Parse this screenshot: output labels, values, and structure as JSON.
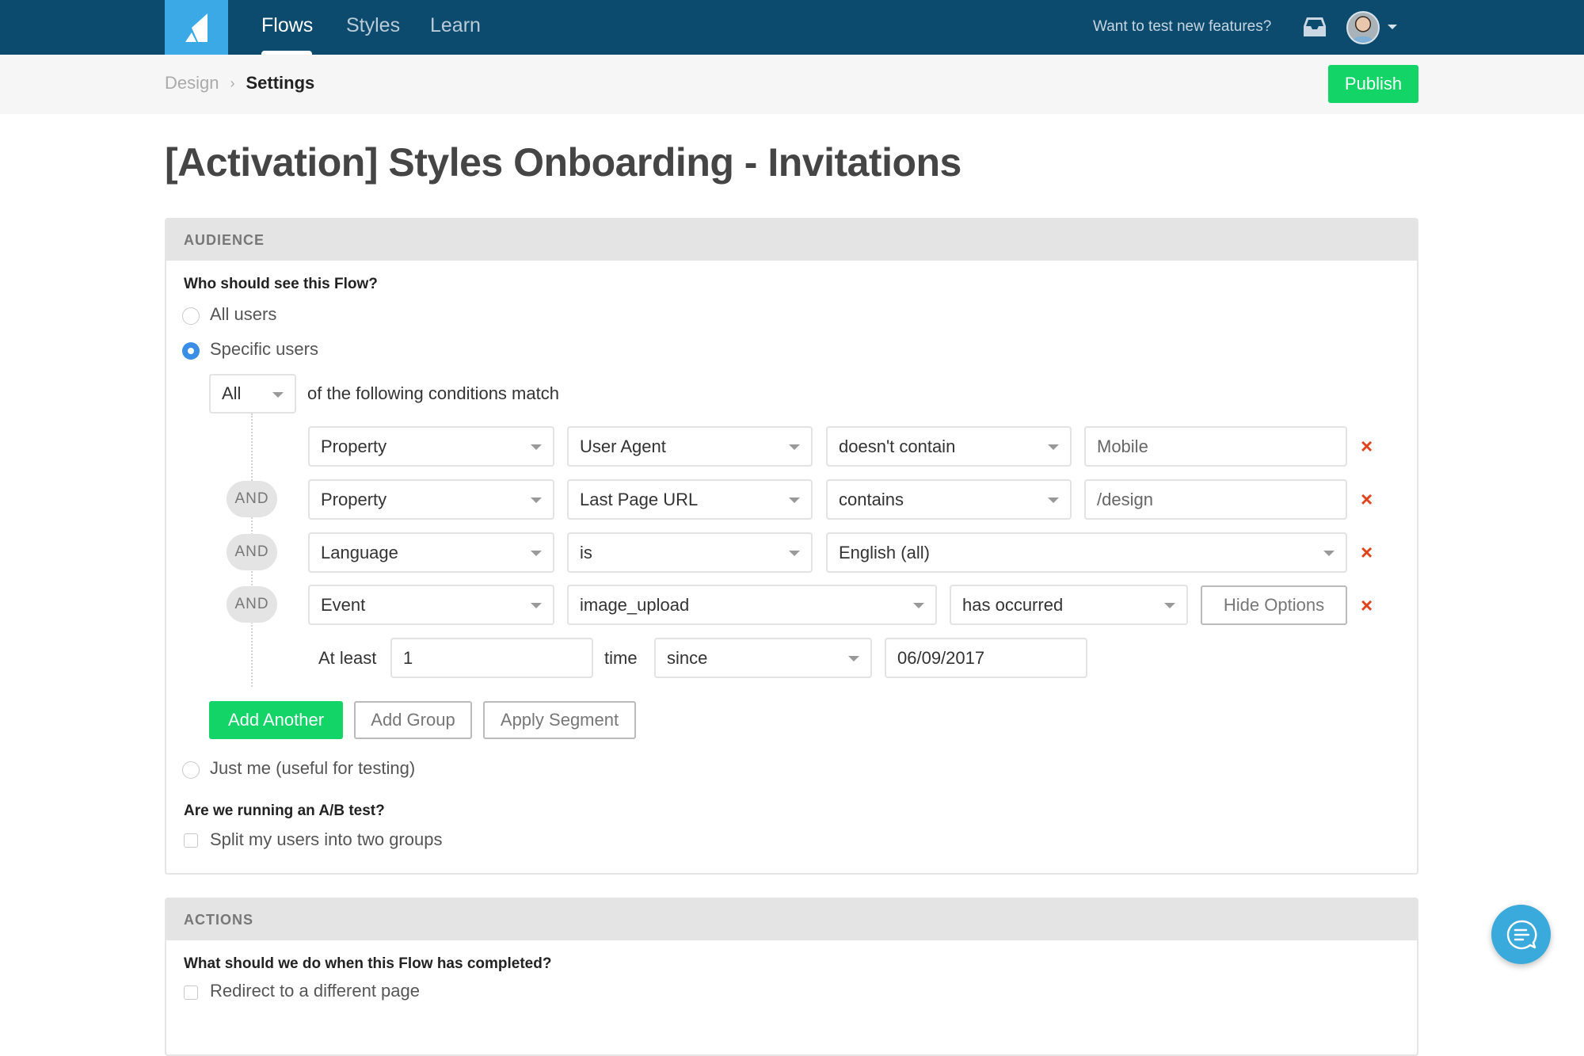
{
  "navbar": {
    "logo": "appcues-logo-icon",
    "tabs": [
      {
        "label": "Flows",
        "active": true
      },
      {
        "label": "Styles",
        "active": false
      },
      {
        "label": "Learn",
        "active": false
      }
    ],
    "feature_link": "Want to test new features?",
    "inbox_icon": "inbox-icon",
    "avatar": "user-avatar",
    "caret_icon": "caret-down-icon"
  },
  "breadcrumb": {
    "parent": "Design",
    "separator": "›",
    "current": "Settings"
  },
  "toolbar": {
    "publish_label": "Publish"
  },
  "page_title": "[Activation] Styles Onboarding - Invitations",
  "audience": {
    "header": "AUDIENCE",
    "question": "Who should see this Flow?",
    "options": [
      {
        "label": "All users",
        "checked": false
      },
      {
        "label": "Specific users",
        "checked": true
      },
      {
        "label": "Just me (useful for testing)",
        "checked": false
      }
    ],
    "match_select": "All",
    "match_text": "of the following conditions match",
    "connector": "AND",
    "conditions": [
      {
        "type": "Property",
        "field": "User Agent",
        "operator": "doesn't contain",
        "value": "Mobile"
      },
      {
        "type": "Property",
        "field": "Last Page URL",
        "operator": "contains",
        "value": "/design"
      },
      {
        "type": "Language",
        "operator": "is",
        "value": "English (all)"
      },
      {
        "type": "Event",
        "field": "image_upload",
        "operator": "has occurred",
        "options_button": "Hide Options"
      }
    ],
    "event_options": {
      "at_least_label": "At least",
      "count": "1",
      "time_label": "time",
      "since_select": "since",
      "date": "06/09/2017"
    },
    "remove_icon": "×",
    "buttons": {
      "add_another": "Add Another",
      "add_group": "Add Group",
      "apply_segment": "Apply Segment"
    },
    "ab_question": "Are we running an A/B test?",
    "ab_option": {
      "label": "Split my users into two groups",
      "checked": false
    }
  },
  "actions": {
    "header": "ACTIONS",
    "question": "What should we do when this Flow has completed?",
    "option": {
      "label": "Redirect to a different page",
      "checked": false
    }
  },
  "colors": {
    "navbar": "#0d4b6e",
    "logo_bg": "#3aa9e6",
    "green": "#12d467",
    "remove_red": "#e0441c",
    "radio_blue": "#3a8ee6"
  }
}
